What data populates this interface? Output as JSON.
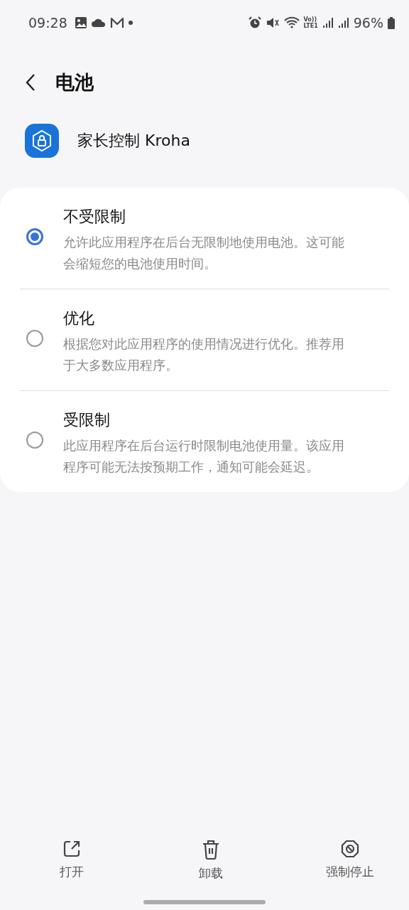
{
  "status_bar": {
    "time": "09:28",
    "network_top": "Vo))",
    "network_bottom": "LTE1",
    "battery": "96%"
  },
  "header": {
    "title": "电池"
  },
  "app": {
    "name": "家长控制 Kroha"
  },
  "options": [
    {
      "title": "不受限制",
      "description": "允许此应用程序在后台无限制地使用电池。这可能会缩短您的电池使用时间。",
      "selected": true
    },
    {
      "title": "优化",
      "description": "根据您对此应用程序的使用情况进行优化。推荐用于大多数应用程序。",
      "selected": false
    },
    {
      "title": "受限制",
      "description": "此应用程序在后台运行时限制电池使用量。该应用程序可能无法按预期工作，通知可能会延迟。",
      "selected": false
    }
  ],
  "actions": [
    {
      "kind": "open",
      "label": "打开"
    },
    {
      "kind": "uninstall",
      "label": "卸载"
    },
    {
      "kind": "stop",
      "label": "强制停止"
    }
  ]
}
